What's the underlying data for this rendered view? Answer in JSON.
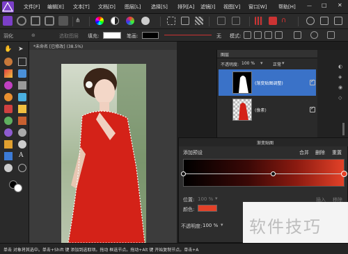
{
  "menu": {
    "file": "文件[F]",
    "edit": "编辑[E]",
    "text": "文本[T]",
    "doc": "文档[D]",
    "layer": "图层[L]",
    "select": "选择[S]",
    "arrange": "排列[A]",
    "filter": "滤镜[I]",
    "view": "视图[V]",
    "window": "窗口[W]",
    "help": "帮助[H]"
  },
  "ctx": {
    "mode": "羽化",
    "select_layer": "选取图层",
    "fill_label": "填充:",
    "stroke_label": "笔画:",
    "none": "无",
    "pattern_label": "模式:"
  },
  "doc": {
    "tab_title": "*未命名 [已修改] (38.5%)"
  },
  "layers": {
    "title": "图层",
    "opacity_label": "不透明度:",
    "opacity_value": "100 %",
    "blend_mode": "正常",
    "items": [
      {
        "name": "(渐变贴图调整)"
      },
      {
        "name": "(像素)"
      }
    ]
  },
  "gradient": {
    "title": "渐变贴图",
    "add_preset": "添加预设",
    "merge": "合并",
    "delete": "删除",
    "reset": "重置",
    "position_label": "位置:",
    "position_value": "100 %",
    "color_label": "颜色:",
    "color_value": "#e34128",
    "insert": "插入",
    "delete_stop": "移除",
    "opacity_label": "不透明度:",
    "opacity_value": "100 %"
  },
  "watermark": "软件技巧",
  "status": "单击 对象将其选中。单击+Shift 键 添加到选取项。拖动 框选节点。拖动+Alt 键 开始复制节点。单击+A"
}
